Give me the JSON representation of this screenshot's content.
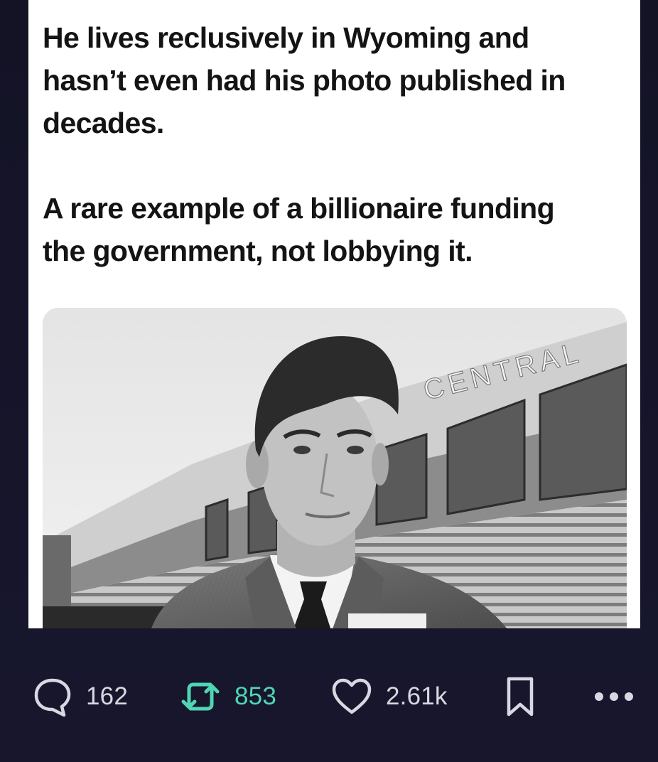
{
  "post": {
    "paragraph_1": "He lives reclusively in Wyoming and\nhasn’t even had his photo published in\ndecades.",
    "paragraph_2": "A rare example of a billionaire funding\nthe government, not  lobbying it.",
    "image": {
      "train_lettering": "CENTRAL"
    }
  },
  "actions": {
    "reply_count": "162",
    "retweet_count": "853",
    "like_count": "2.61k"
  },
  "colors": {
    "background": "#15142a",
    "card": "#ffffff",
    "text": "#141414",
    "count_text": "#d8d8e2",
    "retweet_accent": "#4fd6b4"
  },
  "icons": {
    "reply": "speech-bubble-icon",
    "retweet": "retweet-arrows-icon",
    "like": "heart-icon",
    "bookmark": "bookmark-icon",
    "more": "more-dots-icon"
  }
}
